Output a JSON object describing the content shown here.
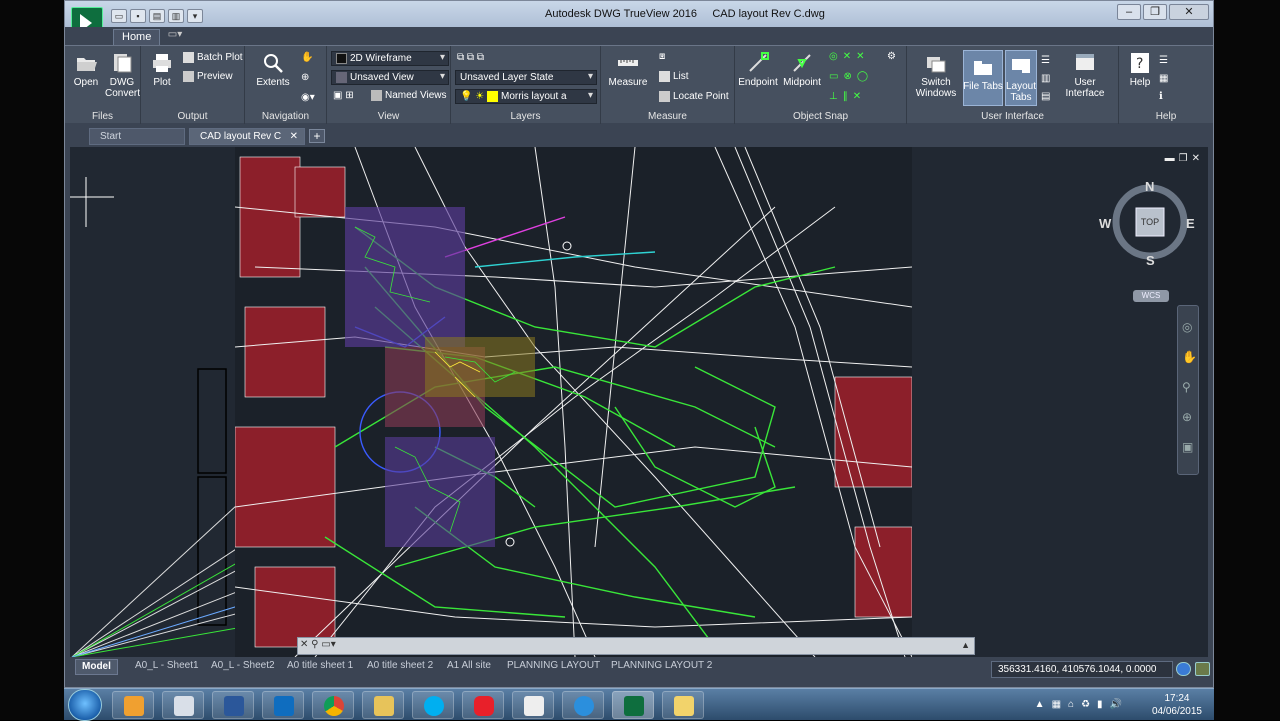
{
  "window": {
    "app_title": "Autodesk DWG TrueView 2016",
    "doc_title": "CAD layout Rev C.dwg"
  },
  "ribbon": {
    "tabs": [
      "Home"
    ],
    "panels": {
      "files": {
        "label": "Files",
        "open": "Open",
        "dwg_convert_line1": "DWG",
        "dwg_convert_line2": "Convert"
      },
      "output": {
        "label": "Output",
        "plot": "Plot",
        "batch_plot": "Batch Plot",
        "preview": "Preview"
      },
      "navigation": {
        "label": "Navigation",
        "extents": "Extents"
      },
      "view": {
        "label": "View",
        "visual_style": "2D Wireframe",
        "saved_view": "Unsaved View",
        "named_views": "Named Views"
      },
      "layers": {
        "label": "Layers",
        "layer_state": "Unsaved Layer State",
        "layer_name": "Morris layout a"
      },
      "measure": {
        "label": "Measure",
        "measure": "Measure",
        "list": "List",
        "locate_point": "Locate Point"
      },
      "object_snap": {
        "label": "Object Snap",
        "endpoint": "Endpoint",
        "midpoint": "Midpoint"
      },
      "user_interface": {
        "label": "User Interface",
        "switch_windows_line1": "Switch",
        "switch_windows_line2": "Windows",
        "file_tabs": "File Tabs",
        "layout_tabs_line1": "Layout",
        "layout_tabs_line2": "Tabs",
        "user_interface_line1": "User",
        "user_interface_line2": "Interface"
      },
      "help": {
        "label": "Help",
        "help": "Help"
      }
    }
  },
  "doc_tabs": [
    {
      "label": "Start"
    },
    {
      "label": "CAD layout Rev C"
    }
  ],
  "viewcube": {
    "north": "N",
    "south": "S",
    "east": "E",
    "west": "W",
    "face": "TOP",
    "wcs": "WCS"
  },
  "layout_tabs": [
    "Model",
    "A0_L - Sheet1",
    "A0_L - Sheet2",
    "A0 title sheet 1",
    "A0 title sheet 2",
    "A1 All site",
    "PLANNING LAYOUT",
    "PLANNING LAYOUT 2"
  ],
  "status": {
    "coordinates": "356331.4160, 410576.1044, 0.0000"
  },
  "taskbar": {
    "time": "17:24",
    "date": "04/06/2015"
  },
  "colors": {
    "canvas": "#212832",
    "ribbon": "#46505f",
    "accent_green": "#39e639",
    "house_red": "#8c1f2a"
  }
}
